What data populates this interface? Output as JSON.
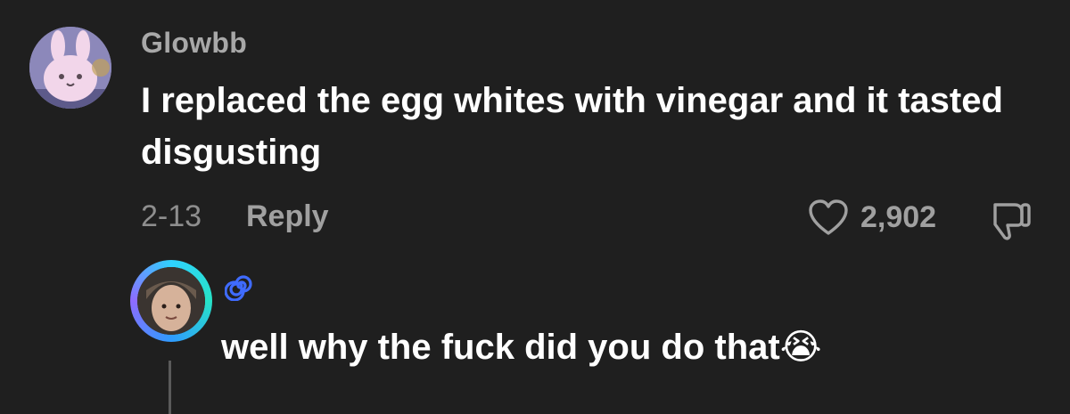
{
  "comment": {
    "username": "Glowbb",
    "text": "I replaced the egg whites with vinegar and it tasted disgusting",
    "date": "2-13",
    "reply_label": "Reply",
    "like_count": "2,902"
  },
  "reply": {
    "username_icon": "spiral-emoji",
    "text": "well why the fuck did you do that",
    "emoji": "😭"
  },
  "colors": {
    "background": "#1f1f1f",
    "username_gray": "#a8a8a8",
    "meta_gray": "#8e8e8e",
    "spiral_blue": "#3f6bff"
  }
}
